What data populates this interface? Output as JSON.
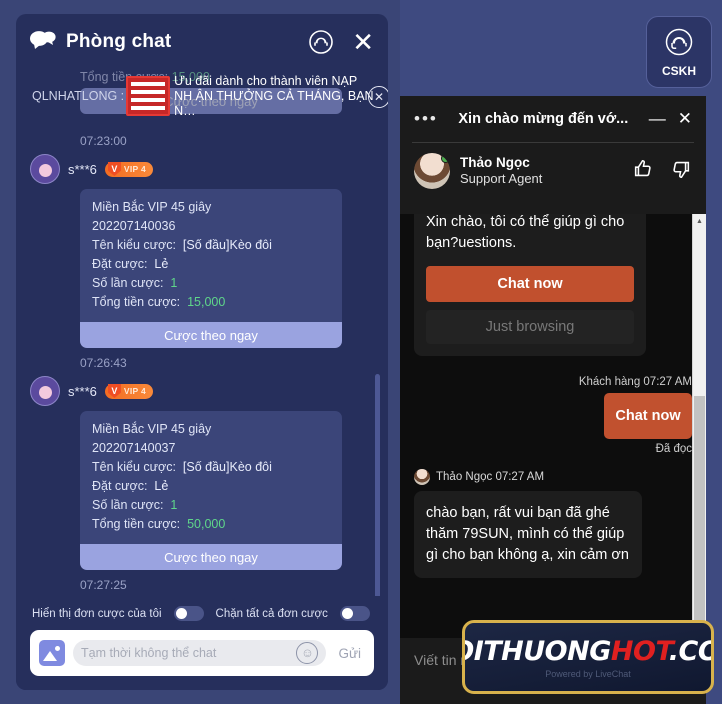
{
  "left_panel": {
    "header": {
      "title": "Phòng chat",
      "chat_icon": "speech-bubbles-icon",
      "support_icon": "headset-icon",
      "close_icon": "close-icon"
    },
    "notification": {
      "user": "QLNHATLONG :",
      "gift_icon": "gift-box-icon",
      "text": "Ưu đãi dành cho thành viên NẠP NH ẬN THƯỞNG CẢ THÁNG, BẠN N…",
      "close_icon": "close-circle-icon"
    },
    "ghost_message": {
      "label": "Tổng tiền cược:",
      "value": "15,000",
      "button": "Cược theo ngay"
    },
    "messages": [
      {
        "time": "07:23:00",
        "user": "s***6",
        "vip_v": "V",
        "vip_label": "VIP 4",
        "lines": [
          {
            "text": "Miền Bắc VIP 45 giây"
          },
          {
            "text": "202207140036"
          },
          {
            "label": "Tên kiểu cược:",
            "value": "[Số đầu]Kèo đôi"
          },
          {
            "label": "Đặt cược:",
            "value": "Lẻ"
          },
          {
            "label": "Số lần cược:",
            "num": "1"
          },
          {
            "label": "Tổng tiền cược:",
            "num": "15,000"
          }
        ],
        "button": "Cược theo ngay"
      },
      {
        "time": "07:26:43",
        "user": "s***6",
        "vip_v": "V",
        "vip_label": "VIP 4",
        "lines": [
          {
            "text": "Miền Bắc VIP 45 giây"
          },
          {
            "text": "202207140037"
          },
          {
            "label": "Tên kiểu cược:",
            "value": "[Số đầu]Kèo đôi"
          },
          {
            "label": "Đặt cược:",
            "value": "Lẻ"
          },
          {
            "label": "Số lần cược:",
            "num": "1"
          },
          {
            "label": "Tổng tiền cược:",
            "num": "50,000"
          }
        ],
        "button": "Cược theo ngay"
      }
    ],
    "last_time": "07:27:25",
    "toggles": [
      {
        "label": "Hiển thị đơn cược của tôi",
        "on": false
      },
      {
        "label": "Chặn tất cả đơn cược",
        "on": false
      }
    ],
    "composer": {
      "image_icon": "image-upload-icon",
      "placeholder": "Tạm thời không thể chat",
      "emoji_icon": "smiley-icon",
      "send_label": "Gửi"
    }
  },
  "cskh_button": {
    "icon": "headset-support-icon",
    "label": "CSKH"
  },
  "livechat": {
    "header": {
      "menu_icon": "more-options-icon",
      "title": "Xin chào mừng đến vớ...",
      "minimize_icon": "minimize-icon",
      "close_icon": "close-icon"
    },
    "agent": {
      "name": "Thảo Ngọc",
      "role": "Support Agent",
      "status": "online",
      "thumbs_up_icon": "thumbs-up-icon",
      "thumbs_down_icon": "thumbs-down-icon"
    },
    "bot_card": {
      "text": "Xin chào, tôi có thể giúp gì cho bạn?uestions.",
      "primary_button": "Chat now",
      "secondary_button": "Just browsing"
    },
    "outgoing": {
      "meta": "Khách hàng 07:27 AM",
      "text": "Chat now",
      "status": "Đã đọc"
    },
    "incoming": {
      "meta": "Thảo Ngọc 07:27 AM",
      "text": "chào bạn, rất vui bạn đã ghé thăm 79SUN, mình có thể giúp gì cho bạn không ạ, xin cảm ơn"
    },
    "footer": {
      "placeholder": "Viết tin nhắn...",
      "powered": "Powered by LiveChat"
    },
    "scrollbar": {
      "up_icon": "scroll-up-arrow",
      "down_icon": "scroll-down-arrow"
    }
  },
  "watermark": {
    "part1": "DOITHUONG",
    "part2": "HOT",
    "part3": ".COM",
    "sub": "Powered by LiveChat"
  },
  "colors": {
    "panel_bg": "#262f5c",
    "card_bg": "#3b4579",
    "accent_button": "#9aa3e0",
    "vip_orange": "#f36c21",
    "money_green": "#5fd68a",
    "livechat_accent": "#c1502e",
    "watermark_gold": "#d8b24c"
  }
}
